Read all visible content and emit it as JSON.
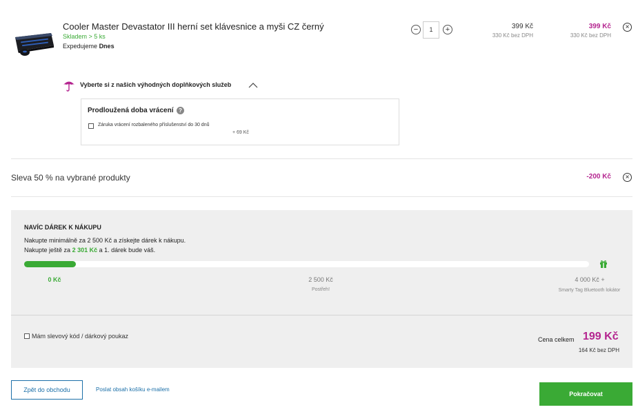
{
  "product": {
    "name": "Cooler Master Devastator III herní set klávesnice a myši CZ černý",
    "stock": "Skladem > 5 ks",
    "shipping_prefix": "Expedujeme",
    "shipping_when": "Dnes",
    "quantity": "1",
    "unit_price": "399 Kč",
    "unit_price_net": "330 Kč bez DPH",
    "total_price": "399 Kč",
    "total_price_net": "330 Kč bez DPH"
  },
  "services": {
    "title": "Vyberte si z našich výhodných doplňkových služeb",
    "box_title": "Prodloužená doba vrácení",
    "help": "?",
    "option_label": "Záruka vrácení rozbaleného příslušenství do 30 dnů",
    "option_price": "+ 69 Kč"
  },
  "discount": {
    "label": "Sleva 50 % na vybrané produkty",
    "value": "-200 Kč"
  },
  "gift": {
    "title": "NAVÍC DÁREK K NÁKUPU",
    "line1": "Nakupte minimálně za 2 500 Kč a získejte dárek k nákupu.",
    "line2_prefix": "Nakupte ještě za",
    "line2_amount": "2 301 Kč",
    "line2_suffix": "a 1. dárek bude váš.",
    "progress": 0.092,
    "milestones": [
      {
        "label": "0 Kč",
        "sub": ""
      },
      {
        "label": "2 500 Kč",
        "sub": "Postřeh!"
      },
      {
        "label": "4 000 Kč +",
        "sub": "Smarty Tag Bluetooth lokátor"
      }
    ]
  },
  "coupon": {
    "label": "Mám slevový kód / dárkový poukaz"
  },
  "summary": {
    "total_label": "Cena celkem",
    "total_value": "199 Kč",
    "total_net": "164 Kč bez DPH"
  },
  "footer": {
    "back_label": "Zpět do obchodu",
    "email_label": "Poslat obsah košíku e-mailem",
    "continue_label": "Pokračovat"
  },
  "colors": {
    "accent_green": "#3aaa35",
    "accent_magenta": "#b4248f",
    "link_blue": "#1b6fa8"
  },
  "icons": {
    "remove": "close-icon",
    "service": "umbrella-icon",
    "collapse": "chevron-up-icon",
    "gift": "gift-icon"
  }
}
